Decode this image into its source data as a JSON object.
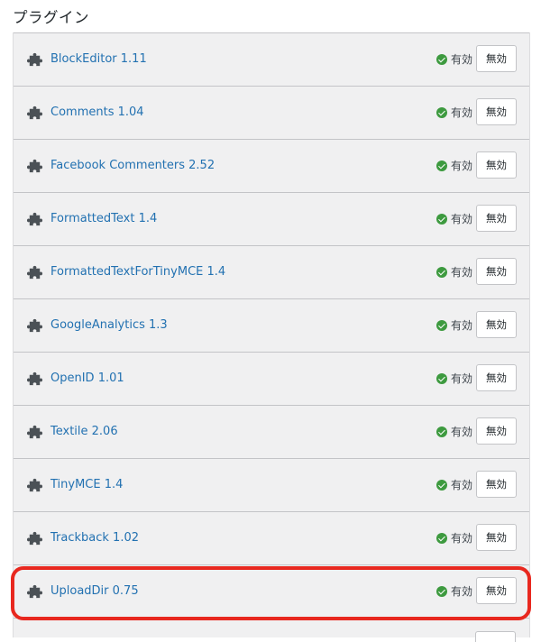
{
  "page_title": "プラグイン",
  "status_label": "有効",
  "deactivate_label": "無効",
  "colors": {
    "link": "#2271b1",
    "active_check": "#3d9a3f",
    "highlight": "#e8281f"
  },
  "icons": {
    "plugin": "puzzle-icon",
    "status": "check-circle-icon"
  },
  "plugins": [
    {
      "name": "BlockEditor 1.11"
    },
    {
      "name": "Comments 1.04"
    },
    {
      "name": "Facebook Commenters 2.52"
    },
    {
      "name": "FormattedText 1.4"
    },
    {
      "name": "FormattedTextForTinyMCE 1.4"
    },
    {
      "name": "GoogleAnalytics 1.3"
    },
    {
      "name": "OpenID 1.01"
    },
    {
      "name": "Textile 2.06"
    },
    {
      "name": "TinyMCE 1.4"
    },
    {
      "name": "Trackback 1.02"
    },
    {
      "name": "UploadDir 0.75"
    }
  ]
}
